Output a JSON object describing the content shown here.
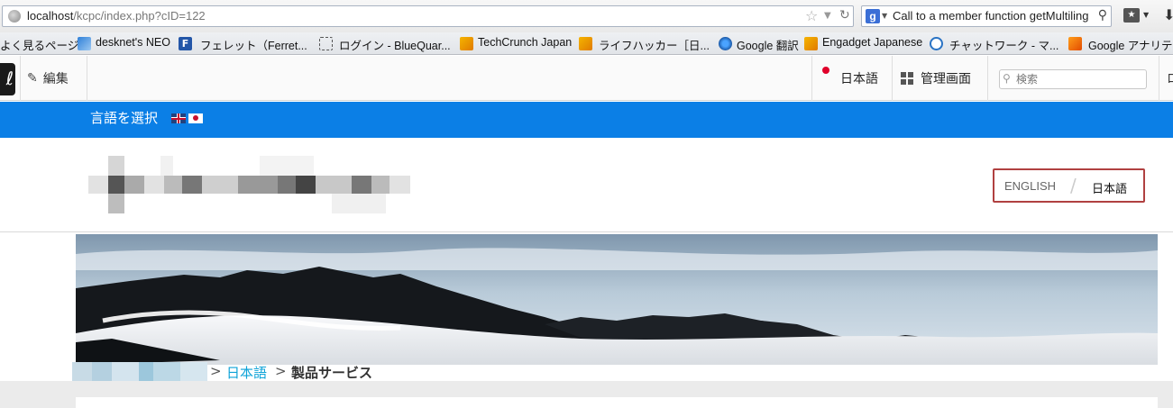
{
  "browser": {
    "url_host": "localhost",
    "url_path": "/kcpc/index.php?cID=122",
    "search_text": "Call to a member function getMultiling",
    "search_engine_icon": "g",
    "bookmarks": [
      {
        "label": "よく見るページ",
        "icon": "none"
      },
      {
        "label": "desknet's NEO",
        "icon": "desknet-icon"
      },
      {
        "label": "フェレット（Ferret...",
        "icon": "ferret-icon"
      },
      {
        "label": "ログイン - BlueQuar...",
        "icon": "blank-page-icon"
      },
      {
        "label": "TechCrunch Japan",
        "icon": "rss-icon"
      },
      {
        "label": "ライフハッカー［日...",
        "icon": "rss-icon"
      },
      {
        "label": "Google 翻訳",
        "icon": "translate-icon"
      },
      {
        "label": "Engadget Japanese",
        "icon": "rss-icon"
      },
      {
        "label": "チャットワーク - マ...",
        "icon": "chatwork-icon"
      },
      {
        "label": "Google アナリテ",
        "icon": "analytics-icon"
      }
    ],
    "ferret_letter": "F"
  },
  "cms": {
    "edit_label": "編集",
    "language_label": "日本語",
    "admin_label": "管理画面",
    "search_placeholder": "検索",
    "right_edge_letter": "ロ"
  },
  "lang_bar": {
    "label": "言語を選択"
  },
  "header": {
    "lang_en": "ENGLISH",
    "lang_separator": "/",
    "lang_jp": "日本語"
  },
  "breadcrumb": {
    "sep": ">",
    "home": "日本語",
    "current": "製品サービス"
  },
  "colors": {
    "lang_bar": "#0b7fe6",
    "switch_border": "#b04040",
    "breadcrumb_link": "#0ea3d8"
  }
}
